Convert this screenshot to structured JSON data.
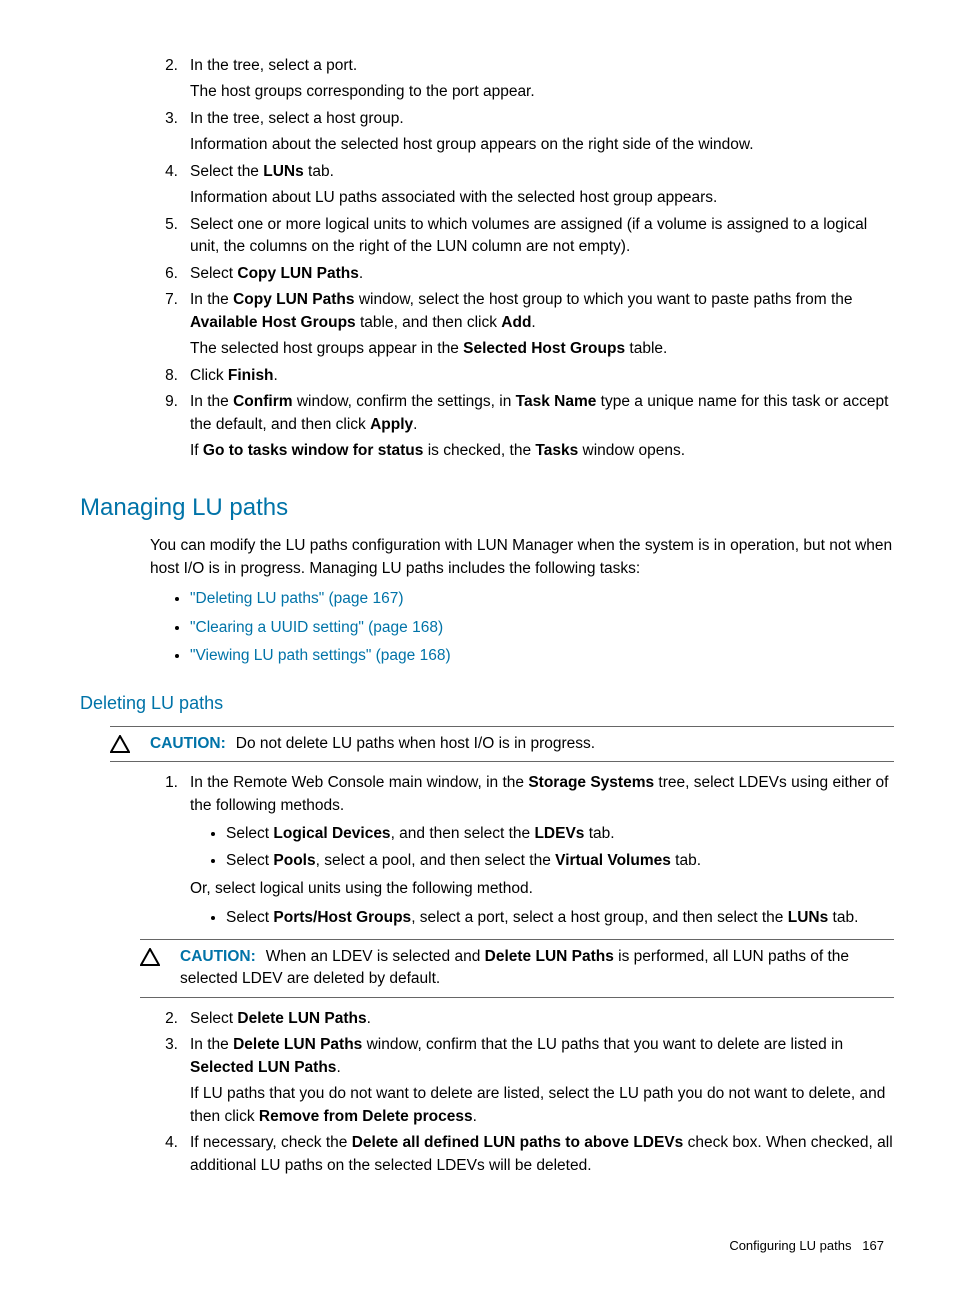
{
  "steps_top": {
    "s2": {
      "num": "2.",
      "text": "In the tree, select a port.",
      "sub": "The host groups corresponding to the port appear."
    },
    "s3": {
      "num": "3.",
      "text": "In the tree, select a host group.",
      "sub": "Information about the selected host group appears on the right side of the window."
    },
    "s4": {
      "num": "4.",
      "p1": "Select the ",
      "b1": "LUNs",
      "p2": " tab.",
      "sub": "Information about LU paths associated with the selected host group appears."
    },
    "s5": {
      "num": "5.",
      "text": "Select one or more logical units to which volumes are assigned (if a volume is assigned to a logical unit, the columns on the right of the LUN column are not empty)."
    },
    "s6": {
      "num": "6.",
      "p1": "Select ",
      "b1": "Copy LUN Paths",
      "p2": "."
    },
    "s7": {
      "num": "7.",
      "p1": "In the ",
      "b1": "Copy LUN Paths",
      "p2": " window, select the host group to which you want to paste paths from the ",
      "b2": "Available Host Groups",
      "p3": " table, and then click ",
      "b3": "Add",
      "p4": ".",
      "sub_p1": "The selected host groups appear in the ",
      "sub_b1": "Selected Host Groups",
      "sub_p2": " table."
    },
    "s8": {
      "num": "8.",
      "p1": "Click ",
      "b1": "Finish",
      "p2": "."
    },
    "s9": {
      "num": "9.",
      "p1": "In the ",
      "b1": "Confirm",
      "p2": " window, confirm the settings, in ",
      "b2": "Task Name",
      "p3": " type a unique name for this task or accept the default, and then click ",
      "b3": "Apply",
      "p4": ".",
      "sub_p1": "If ",
      "sub_b1": "Go to tasks window for status",
      "sub_p2": " is checked, the ",
      "sub_b2": "Tasks",
      "sub_p3": " window opens."
    }
  },
  "section": {
    "heading": "Managing LU paths",
    "intro": "You can modify the LU paths configuration with LUN Manager when the system is in operation, but not when host I/O is in progress. Managing LU paths includes the following tasks:",
    "links": {
      "l1": "\"Deleting LU paths\" (page 167)",
      "l2": "\"Clearing a UUID setting\" (page 168)",
      "l3": "\"Viewing LU path settings\" (page 168)"
    }
  },
  "subsection": {
    "heading": "Deleting LU paths",
    "caution1": {
      "label": "CAUTION:",
      "text": "Do not delete LU paths when host I/O is in progress."
    },
    "s1": {
      "num": "1.",
      "p1": "In the Remote Web Console main window, in the ",
      "b1": "Storage Systems",
      "p2": " tree, select LDEVs using either of the following methods.",
      "bul1_p1": "Select ",
      "bul1_b1": "Logical Devices",
      "bul1_p2": ", and then select the ",
      "bul1_b2": "LDEVs",
      "bul1_p3": " tab.",
      "bul2_p1": "Select ",
      "bul2_b1": "Pools",
      "bul2_p2": ", select a pool, and then select the ",
      "bul2_b2": "Virtual Volumes",
      "bul2_p3": " tab.",
      "mid": "Or, select logical units using the following method.",
      "bul3_p1": "Select ",
      "bul3_b1": "Ports/Host Groups",
      "bul3_p2": ", select a port, select a host group, and then select the ",
      "bul3_b2": "LUNs",
      "bul3_p3": " tab."
    },
    "caution2": {
      "label": "CAUTION:",
      "p1": "When an LDEV is selected and ",
      "b1": "Delete LUN Paths",
      "p2": " is performed, all LUN paths of the selected LDEV are deleted by default."
    },
    "s2": {
      "num": "2.",
      "p1": "Select ",
      "b1": "Delete LUN Paths",
      "p2": "."
    },
    "s3": {
      "num": "3.",
      "p1": "In the ",
      "b1": "Delete LUN Paths",
      "p2": " window, confirm that the LU paths that you want to delete are listed in ",
      "b2": "Selected LUN Paths",
      "p3": ".",
      "sub_p1": "If LU paths that you do not want to delete are listed, select the LU path you do not want to delete, and then click ",
      "sub_b1": "Remove from Delete process",
      "sub_p2": "."
    },
    "s4": {
      "num": "4.",
      "p1": "If necessary, check the ",
      "b1": "Delete all defined LUN paths to above LDEVs",
      "p2": " check box. When checked, all additional LU paths on the selected LDEVs will be deleted."
    }
  },
  "footer": {
    "text": "Configuring LU paths",
    "page": "167"
  }
}
